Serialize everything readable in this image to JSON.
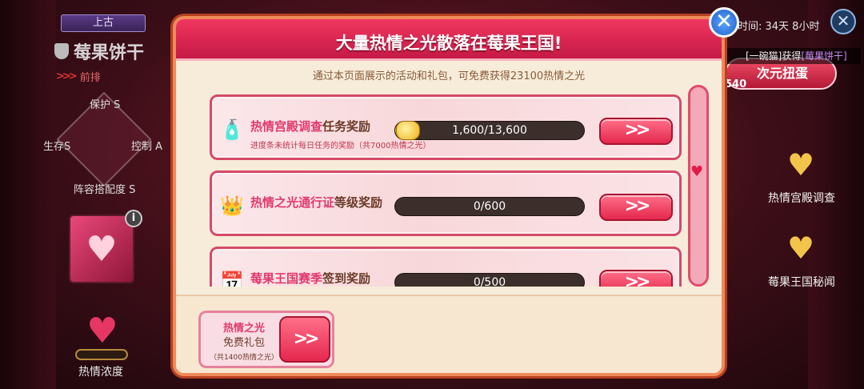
{
  "left_panel": {
    "era_tab": "上古",
    "cookie_name": "莓果饼干",
    "position": "前排",
    "stats": {
      "protect": "保护 S",
      "survive": "生存S",
      "control": "控制 A",
      "team": "阵容搭配度 S"
    },
    "heart_label": "热情浓度"
  },
  "top_right": {
    "timer": "时间: 34天 8小时",
    "ticker_prefix": "[一碗猫]获得",
    "ticker_link": "[莓果饼干]",
    "gacha_label": "次元扭蛋",
    "gacha_count": "540"
  },
  "side_items": [
    {
      "label": "热情宫殿调查"
    },
    {
      "label": "莓果王国秘闻"
    }
  ],
  "dialog": {
    "title": "大量热情之光散落在莓果王国!",
    "subtitle": "通过本页面展示的活动和礼包，可免费获得23100热情之光",
    "tasks": [
      {
        "title_highlight": "热情宫殿调查",
        "title_rest": "任务奖励",
        "note": "进度条未统计每日任务的奖励（共7000热情之光）",
        "progress_text": "1,600/13,600",
        "progress_fraction": 0.118,
        "icon": "perfume-bottle-icon"
      },
      {
        "title_highlight": "热情之光通行证",
        "title_rest": "等级奖励",
        "note": "",
        "progress_text": "0/600",
        "progress_fraction": 0,
        "icon": "crown-icon"
      },
      {
        "title_highlight": "莓果王国赛季",
        "title_rest": "签到奖励",
        "note": "",
        "progress_text": "0/500",
        "progress_fraction": 0,
        "icon": "calendar-icon"
      }
    ],
    "gift": {
      "title": "热情之光",
      "subtitle": "免费礼包",
      "note": "（共1400热情之光）"
    }
  },
  "colors": {
    "accent": "#e4284e",
    "highlight_text": "#e23a6c",
    "dialog_bg": "#f6ecd9"
  }
}
